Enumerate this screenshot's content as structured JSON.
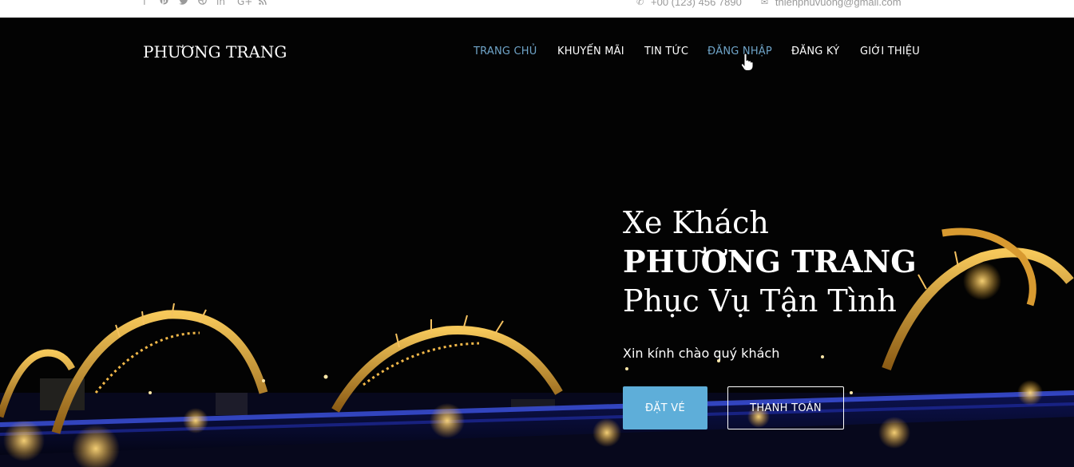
{
  "topbar": {
    "social_icons": [
      "facebook-icon",
      "pinterest-icon",
      "twitter-icon",
      "dribbble-icon",
      "linkedin-icon",
      "google-plus-icon",
      "rss-icon"
    ],
    "social_glyphs": [
      "f",
      "℗",
      "🐦",
      "◎",
      "in",
      "G+",
      "⌇"
    ],
    "phone_icon": "phone-icon",
    "phone": "+00 (123) 456 7890",
    "email_icon": "envelope-icon",
    "email": "thienphuvuong@gmail.com"
  },
  "brand": {
    "logo": "PHƯƠNG TRANG"
  },
  "nav": {
    "items": [
      {
        "label": "TRANG CHỦ",
        "state": "active"
      },
      {
        "label": "KHUYẾN MÃI"
      },
      {
        "label": "TIN TỨC"
      },
      {
        "label": "ĐĂNG NHẬP",
        "state": "hover"
      },
      {
        "label": "ĐĂNG KÝ"
      },
      {
        "label": "GIỚI THIỆU"
      }
    ]
  },
  "hero": {
    "line1": "Xe Khách",
    "line2": "PHƯƠNG TRANG",
    "line3": "Phục Vụ Tận Tình",
    "greeting": "Xin kính chào quý khách",
    "book_button": "ĐẶT VÉ",
    "pay_button": "THANH TOÁN"
  },
  "colors": {
    "accent": "#5eaed9",
    "nav_active": "#6fa4c8",
    "background": "#030303",
    "topbar_text": "#9a9a9a"
  }
}
